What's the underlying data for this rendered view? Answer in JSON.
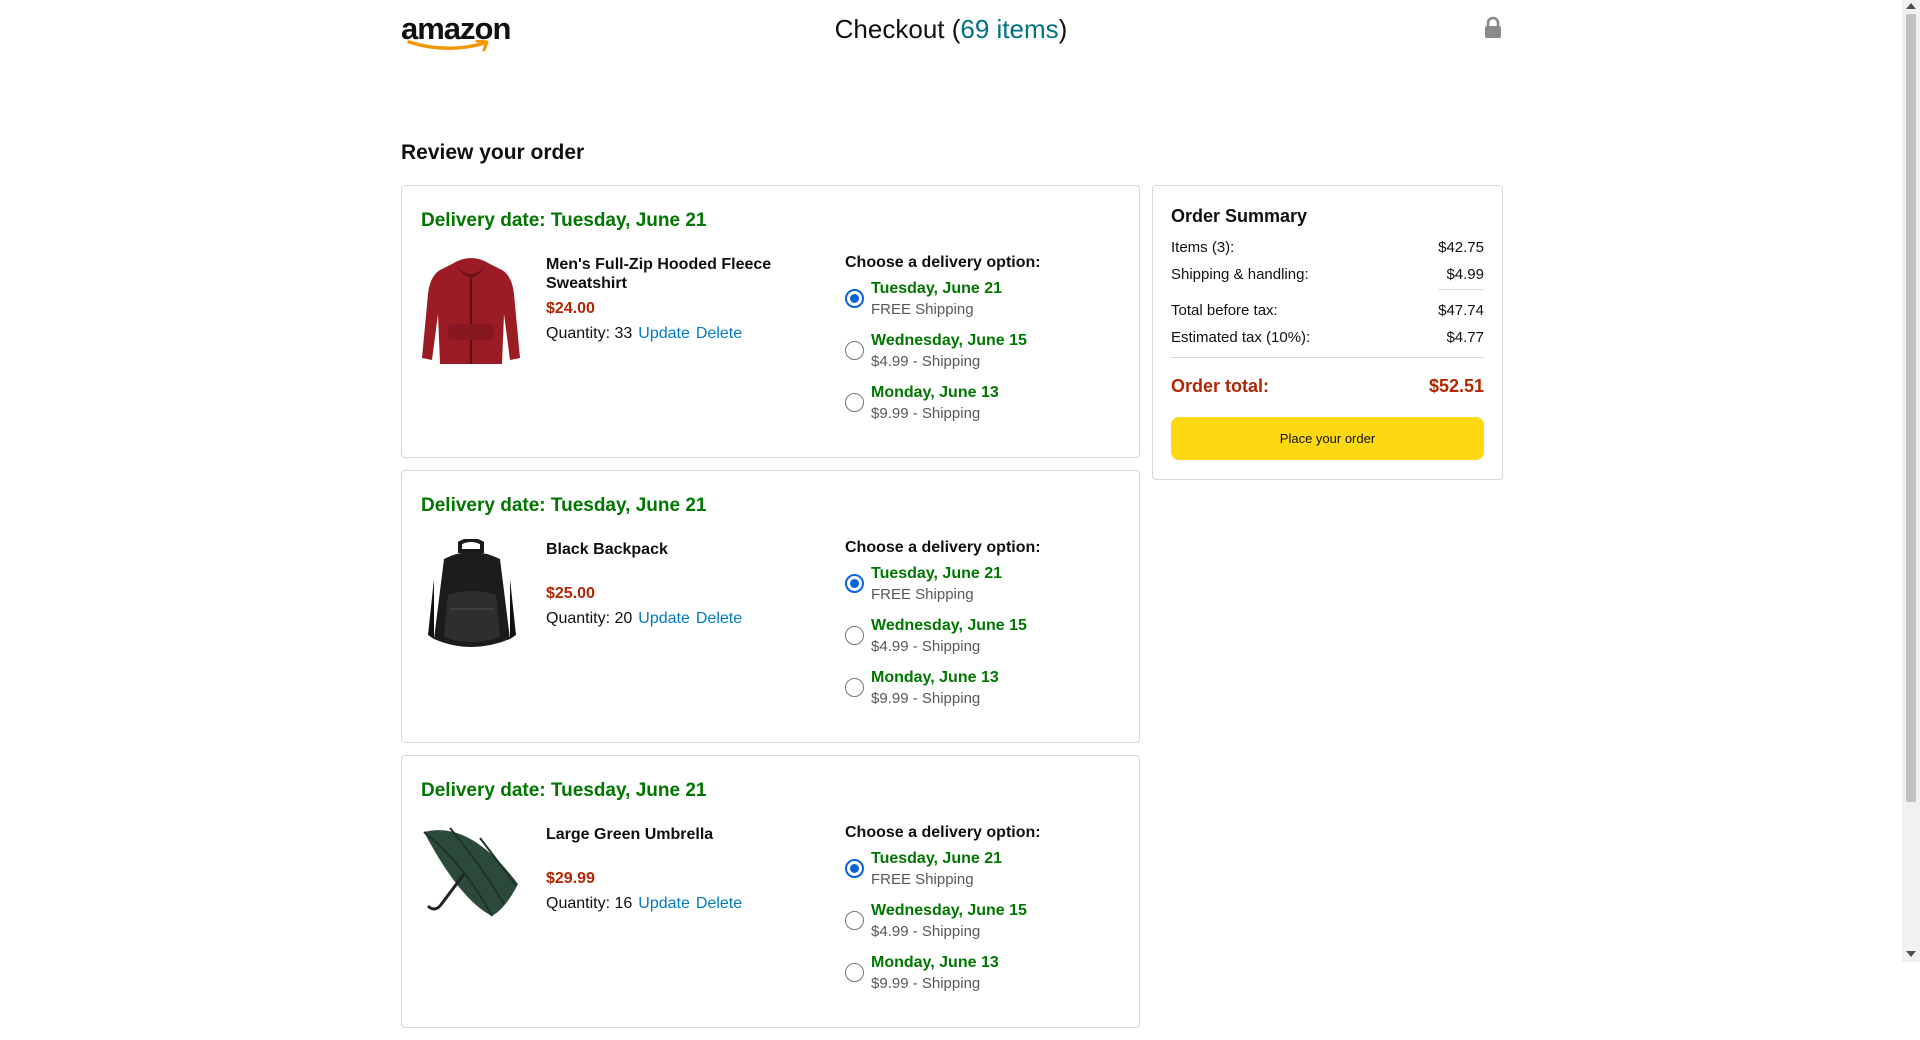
{
  "header": {
    "logo_text": "amazon",
    "checkout_prefix": "Checkout (",
    "items_count_text": "69 items",
    "checkout_suffix": ")",
    "lock_icon": "lock-icon"
  },
  "review_title": "Review your order",
  "options_title": "Choose a delivery option:",
  "update_label": "Update",
  "delete_label": "Delete",
  "orders": [
    {
      "delivery_date": "Delivery date: Tuesday, June 21",
      "product_name": "Men's Full-Zip Hooded Fleece Sweatshirt",
      "price": "$24.00",
      "quantity": "Quantity: 33",
      "image": "red-hoodie-image",
      "options": [
        {
          "date": "Tuesday, June 21",
          "price": "FREE Shipping",
          "selected": true
        },
        {
          "date": "Wednesday, June 15",
          "price": "$4.99 - Shipping",
          "selected": false
        },
        {
          "date": "Monday, June 13",
          "price": "$9.99 - Shipping",
          "selected": false
        }
      ]
    },
    {
      "delivery_date": "Delivery date: Tuesday, June 21",
      "product_name": "Black Backpack",
      "price": "$25.00",
      "quantity": "Quantity: 20",
      "image": "black-backpack-image",
      "options": [
        {
          "date": "Tuesday, June 21",
          "price": "FREE Shipping",
          "selected": true
        },
        {
          "date": "Wednesday, June 15",
          "price": "$4.99 - Shipping",
          "selected": false
        },
        {
          "date": "Monday, June 13",
          "price": "$9.99 - Shipping",
          "selected": false
        }
      ]
    },
    {
      "delivery_date": "Delivery date: Tuesday, June 21",
      "product_name": "Large Green Umbrella",
      "price": "$29.99",
      "quantity": "Quantity: 16",
      "image": "green-umbrella-image",
      "options": [
        {
          "date": "Tuesday, June 21",
          "price": "FREE Shipping",
          "selected": true
        },
        {
          "date": "Wednesday, June 15",
          "price": "$4.99 - Shipping",
          "selected": false
        },
        {
          "date": "Monday, June 13",
          "price": "$9.99 - Shipping",
          "selected": false
        }
      ]
    }
  ],
  "summary": {
    "title": "Order Summary",
    "items_label": "Items (3):",
    "items_value": "$42.75",
    "shipping_label": "Shipping & handling:",
    "shipping_value": "$4.99",
    "before_tax_label": "Total before tax:",
    "before_tax_value": "$47.74",
    "tax_label": "Estimated tax (10%):",
    "tax_value": "$4.77",
    "total_label": "Order total:",
    "total_value": "$52.51",
    "place_order_label": "Place your order"
  },
  "colors": {
    "green": "#007600",
    "price_red": "#b12704",
    "link_blue": "#017cc0",
    "teal": "#017185",
    "button_yellow": "#ffd814"
  }
}
